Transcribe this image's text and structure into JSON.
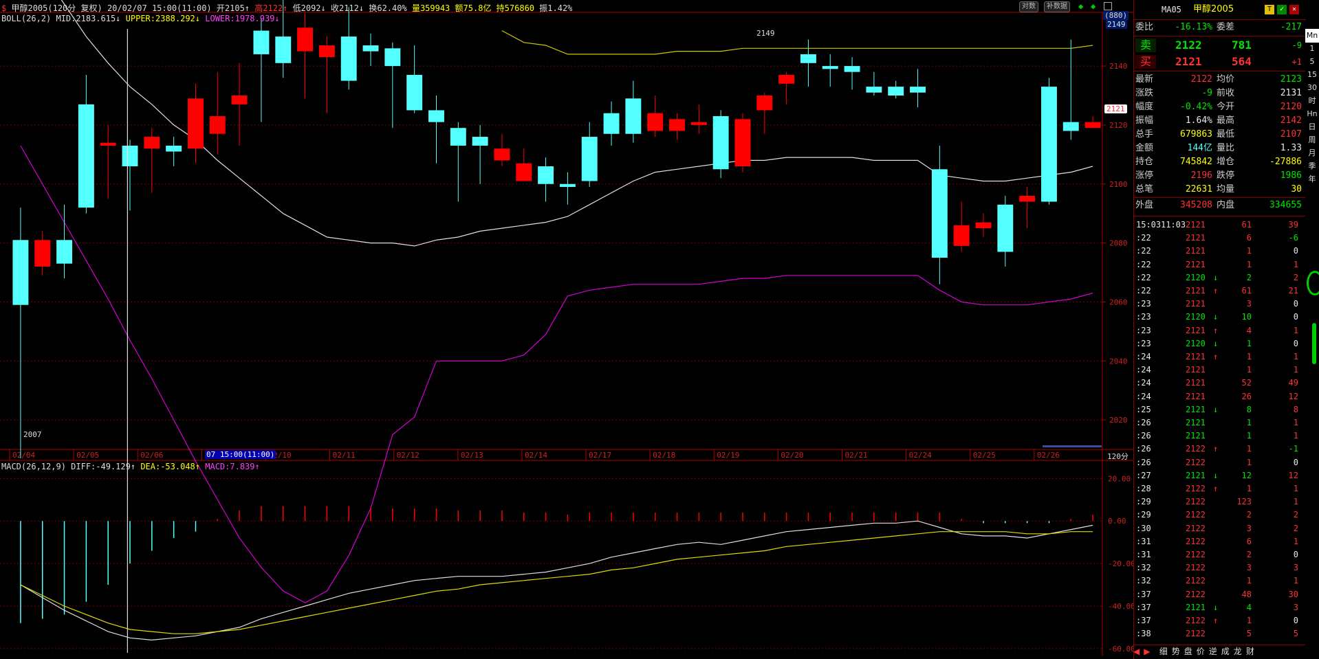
{
  "header": {
    "symbol_title": "甲醇2005(120分 复权) 20/02/07 15:00(11:00)",
    "open": "开2105↑",
    "high": "高2122↑",
    "low": "低2092↓",
    "close": "收2112↓",
    "turnover": "换62.40%",
    "volume": "量359943",
    "amount": "额75.8亿",
    "position": "持576860",
    "amplitude": "振1.42%",
    "btn_period": "对数",
    "btn_supplement": "补数据"
  },
  "boll_header": {
    "name": "BOLL(26,2)",
    "mid": "MID:2183.615↓",
    "upper": "UPPER:2388.292↓",
    "lower": "LOWER:1978.939↓"
  },
  "macd_header": {
    "name": "MACD(26,12,9)",
    "diff": "DIFF:-49.129↑",
    "dea": "DEA:-53.048↑",
    "macd": "MACD:7.839↑"
  },
  "price_axis": {
    "top_badge_1": "(880)",
    "top_badge_2": "2149",
    "labels": [
      "2140",
      "2120",
      "2100",
      "2080",
      "2060",
      "2040",
      "2020"
    ],
    "current_price_tag": "2121",
    "period_label": "120分"
  },
  "macd_axis": {
    "labels": [
      "20.00",
      "0.00",
      "-20.00",
      "-40.00",
      "-60.00"
    ]
  },
  "annotations": {
    "peak_label": "2149",
    "trough_label": "2007",
    "cursor_time": "07 15:00(11:00)"
  },
  "date_axis": {
    "dates": [
      "02/04",
      "02/05",
      "02/06",
      "02/07",
      "02/10",
      "02/11",
      "02/12",
      "02/13",
      "02/14",
      "02/17",
      "02/18",
      "02/19",
      "02/20",
      "02/21",
      "02/24",
      "02/25",
      "02/26"
    ]
  },
  "chart_data": {
    "type": "candlestick",
    "price_range": [
      2000,
      2150
    ],
    "candles": [
      {
        "o": 2081,
        "c": 2059,
        "h": 2092,
        "l": 2007,
        "up": false
      },
      {
        "o": 2072,
        "c": 2081,
        "h": 2084,
        "l": 2069,
        "up": true
      },
      {
        "o": 2081,
        "c": 2073,
        "h": 2093,
        "l": 2068,
        "up": false
      },
      {
        "o": 2127,
        "c": 2092,
        "h": 2137,
        "l": 2090,
        "up": false
      },
      {
        "o": 2113,
        "c": 2114,
        "h": 2120,
        "l": 2095,
        "up": false
      },
      {
        "o": 2113,
        "c": 2106,
        "h": 2115,
        "l": 2091,
        "up": true
      },
      {
        "o": 2112,
        "c": 2116,
        "h": 2119,
        "l": 2097,
        "up": true
      },
      {
        "o": 2113,
        "c": 2111,
        "h": 2116,
        "l": 2106,
        "up": true
      },
      {
        "o": 2112,
        "c": 2129,
        "h": 2134,
        "l": 2107,
        "up": false
      },
      {
        "o": 2117,
        "c": 2123,
        "h": 2138,
        "l": 2110,
        "up": false
      },
      {
        "o": 2127,
        "c": 2130,
        "h": 2141,
        "l": 2113,
        "up": false
      },
      {
        "o": 2152,
        "c": 2144,
        "h": 2156,
        "l": 2121,
        "up": false
      },
      {
        "o": 2150,
        "c": 2141,
        "h": 2163,
        "l": 2136,
        "up": false
      },
      {
        "o": 2145,
        "c": 2153,
        "h": 2158,
        "l": 2129,
        "up": true
      },
      {
        "o": 2143,
        "c": 2147,
        "h": 2150,
        "l": 2124,
        "up": true
      },
      {
        "o": 2150,
        "c": 2135,
        "h": 2160,
        "l": 2132,
        "up": false
      },
      {
        "o": 2147,
        "c": 2145,
        "h": 2151,
        "l": 2140,
        "up": false
      },
      {
        "o": 2146,
        "c": 2140,
        "h": 2148,
        "l": 2119,
        "up": true
      },
      {
        "o": 2137,
        "c": 2125,
        "h": 2147,
        "l": 2124,
        "up": true
      },
      {
        "o": 2125,
        "c": 2121,
        "h": 2130,
        "l": 2107,
        "up": true
      },
      {
        "o": 2119,
        "c": 2113,
        "h": 2121,
        "l": 2094,
        "up": true
      },
      {
        "o": 2116,
        "c": 2113,
        "h": 2120,
        "l": 2100,
        "up": true
      },
      {
        "o": 2108,
        "c": 2112,
        "h": 2117,
        "l": 2106,
        "up": true
      },
      {
        "o": 2101,
        "c": 2107,
        "h": 2112,
        "l": 2104,
        "up": true
      },
      {
        "o": 2106,
        "c": 2100,
        "h": 2109,
        "l": 2094,
        "up": true
      },
      {
        "o": 2100,
        "c": 2099,
        "h": 2104,
        "l": 2093,
        "up": true
      },
      {
        "o": 2116,
        "c": 2101,
        "h": 2121,
        "l": 2099,
        "up": true
      },
      {
        "o": 2124,
        "c": 2117,
        "h": 2128,
        "l": 2113,
        "up": true
      },
      {
        "o": 2129,
        "c": 2117,
        "h": 2135,
        "l": 2114,
        "up": false
      },
      {
        "o": 2118,
        "c": 2124,
        "h": 2130,
        "l": 2116,
        "up": true
      },
      {
        "o": 2118,
        "c": 2122,
        "h": 2124,
        "l": 2115,
        "up": false
      },
      {
        "o": 2120,
        "c": 2121,
        "h": 2127,
        "l": 2117,
        "up": false
      },
      {
        "o": 2123,
        "c": 2105,
        "h": 2125,
        "l": 2102,
        "up": true
      },
      {
        "o": 2106,
        "c": 2122,
        "h": 2124,
        "l": 2104,
        "up": false
      },
      {
        "o": 2125,
        "c": 2130,
        "h": 2131,
        "l": 2117,
        "up": false
      },
      {
        "o": 2134,
        "c": 2137,
        "h": 2138,
        "l": 2127,
        "up": false
      },
      {
        "o": 2144,
        "c": 2141,
        "h": 2149,
        "l": 2133,
        "up": true
      },
      {
        "o": 2140,
        "c": 2139,
        "h": 2144,
        "l": 2133,
        "up": true
      },
      {
        "o": 2140,
        "c": 2138,
        "h": 2143,
        "l": 2132,
        "up": true
      },
      {
        "o": 2133,
        "c": 2131,
        "h": 2138,
        "l": 2130,
        "up": true
      },
      {
        "o": 2133,
        "c": 2130,
        "h": 2135,
        "l": 2129,
        "up": false
      },
      {
        "o": 2133,
        "c": 2131,
        "h": 2139,
        "l": 2126,
        "up": true
      },
      {
        "o": 2105,
        "c": 2075,
        "h": 2113,
        "l": 2066,
        "up": true
      },
      {
        "o": 2079,
        "c": 2086,
        "h": 2094,
        "l": 2077,
        "up": false
      },
      {
        "o": 2085,
        "c": 2087,
        "h": 2090,
        "l": 2082,
        "up": false
      },
      {
        "o": 2093,
        "c": 2077,
        "h": 2096,
        "l": 2072,
        "up": false
      },
      {
        "o": 2094,
        "c": 2096,
        "h": 2099,
        "l": 2085,
        "up": false
      },
      {
        "o": 2133,
        "c": 2094,
        "h": 2136,
        "l": 2093,
        "up": false
      },
      {
        "o": 2121,
        "c": 2118,
        "h": 2149,
        "l": 2115,
        "up": true
      },
      {
        "o": 2119,
        "c": 2121,
        "h": 2123,
        "l": 2119,
        "up": false
      }
    ],
    "boll_mid": [
      2183,
      2172,
      2161,
      2150,
      2141,
      2133,
      2127,
      2120,
      2115,
      2108,
      2102,
      2096,
      2090,
      2086,
      2082,
      2081,
      2080,
      2080,
      2079,
      2081,
      2082,
      2084,
      2085,
      2086,
      2087,
      2089,
      2093,
      2097,
      2101,
      2104,
      2105,
      2106,
      2107,
      2108,
      2108,
      2109,
      2109,
      2109,
      2109,
      2108,
      2108,
      2108,
      2103,
      2102,
      2101,
      2101,
      2102,
      2103,
      2104,
      2106
    ],
    "boll_upper": [
      null,
      null,
      null,
      null,
      null,
      null,
      null,
      null,
      null,
      null,
      null,
      null,
      null,
      null,
      null,
      null,
      null,
      null,
      null,
      null,
      null,
      null,
      2152,
      2148,
      2147,
      2144,
      2144,
      2144,
      2144,
      2144,
      2145,
      2145,
      2145,
      2146,
      2146,
      2146,
      2146,
      2146,
      2146,
      2146,
      2146,
      2146,
      2146,
      2146,
      2146,
      2146,
      2146,
      2146,
      2146,
      2147
    ],
    "boll_lower": [
      2113,
      2100,
      2087,
      2074,
      2061,
      2047,
      2034,
      2020,
      2006,
      1993,
      1980,
      1970,
      1962,
      1958,
      1962,
      1974,
      1990,
      2015,
      2021,
      2040,
      2040,
      2040,
      2040,
      2042,
      2049,
      2062,
      2064,
      2065,
      2066,
      2066,
      2066,
      2066,
      2067,
      2068,
      2068,
      2069,
      2069,
      2069,
      2069,
      2069,
      2069,
      2069,
      2064,
      2060,
      2059,
      2059,
      2059,
      2060,
      2061,
      2063
    ],
    "macd_bars": [
      -48,
      -46,
      -44,
      -38,
      -30,
      -20,
      -14,
      -8,
      -5,
      1,
      5,
      7,
      7,
      7,
      7,
      7,
      6,
      6,
      6,
      6,
      5,
      5,
      5,
      4,
      4,
      3,
      4,
      4,
      4,
      4,
      4,
      4,
      4,
      4,
      4,
      4,
      4,
      4,
      4,
      4,
      4,
      4,
      4,
      1,
      -1,
      -1,
      -1,
      -1,
      1,
      3
    ],
    "macd_diff": [
      -30,
      -36,
      -42,
      -47,
      -52,
      -55,
      -56,
      -55,
      -54,
      -52,
      -50,
      -46,
      -43,
      -40,
      -37,
      -34,
      -32,
      -30,
      -28,
      -27,
      -26,
      -26,
      -26,
      -25,
      -24,
      -22,
      -20,
      -17,
      -15,
      -13,
      -11,
      -10,
      -11,
      -9,
      -7,
      -5,
      -4,
      -3,
      -2,
      -1,
      -1,
      0,
      -3,
      -6,
      -7,
      -7,
      -8,
      -6,
      -4,
      -2
    ],
    "macd_dea": [
      -30,
      -35,
      -40,
      -44,
      -48,
      -51,
      -52,
      -53,
      -53,
      -52,
      -51,
      -49,
      -47,
      -45,
      -43,
      -41,
      -39,
      -37,
      -35,
      -33,
      -32,
      -30,
      -29,
      -28,
      -27,
      -26,
      -25,
      -23,
      -22,
      -20,
      -18,
      -17,
      -16,
      -15,
      -14,
      -12,
      -11,
      -10,
      -9,
      -8,
      -7,
      -6,
      -5,
      -5,
      -5,
      -5,
      -6,
      -6,
      -5,
      -5
    ]
  },
  "right_panel": {
    "title_ma": "MA05",
    "title_name": "甲醇2005",
    "icon_t": "T",
    "weibi_label": "委比",
    "weibi_value": "-16.13%",
    "weicha_label": "委差",
    "weicha_value": "-217",
    "sell_label": "卖",
    "sell_price": "2122",
    "sell_qty": "781",
    "sell_diff": "-9",
    "buy_label": "买",
    "buy_price": "2121",
    "buy_qty": "564",
    "buy_diff": "+1",
    "stats": [
      {
        "l1": "最新",
        "v1": "2122",
        "c1": "red",
        "l2": "均价",
        "v2": "2123",
        "c2": "green"
      },
      {
        "l1": "涨跌",
        "v1": "-9",
        "c1": "green",
        "l2": "前收",
        "v2": "2131",
        "c2": "white"
      },
      {
        "l1": "幅度",
        "v1": "-0.42%",
        "c1": "green",
        "l2": "今开",
        "v2": "2120",
        "c2": "red"
      },
      {
        "l1": "振幅",
        "v1": "1.64%",
        "c1": "white",
        "l2": "最高",
        "v2": "2142",
        "c2": "red"
      },
      {
        "l1": "总手",
        "v1": "679863",
        "c1": "yellow",
        "l2": "最低",
        "v2": "2107",
        "c2": "red"
      },
      {
        "l1": "金额",
        "v1": "144亿",
        "c1": "cyan",
        "l2": "量比",
        "v2": "1.33",
        "c2": "white"
      },
      {
        "l1": "持仓",
        "v1": "745842",
        "c1": "yellow",
        "l2": "增仓",
        "v2": "-27886",
        "c2": "yellow"
      },
      {
        "l1": "涨停",
        "v1": "2196",
        "c1": "red",
        "l2": "跌停",
        "v2": "1986",
        "c2": "green"
      },
      {
        "l1": "总笔",
        "v1": "22631",
        "c1": "yellow",
        "l2": "均量",
        "v2": "30",
        "c2": "yellow"
      }
    ],
    "outer_label": "外盘",
    "outer_value": "345208",
    "inner_label": "内盘",
    "inner_value": "334655",
    "ticks": [
      {
        "t": "15:03",
        "t2": "11:03",
        "p": "2121",
        "a": "",
        "v": "61",
        "d": "39",
        "vc": "red",
        "dc": "red"
      },
      {
        "t": ":22",
        "t2": "",
        "p": "2121",
        "a": "",
        "v": "6",
        "d": "-6",
        "vc": "red",
        "dc": "green"
      },
      {
        "t": ":22",
        "t2": "",
        "p": "2121",
        "a": "",
        "v": "1",
        "d": "0",
        "vc": "red",
        "dc": "white"
      },
      {
        "t": ":22",
        "t2": "",
        "p": "2121",
        "a": "",
        "v": "1",
        "d": "1",
        "vc": "red",
        "dc": "red"
      },
      {
        "t": ":22",
        "t2": "",
        "p": "2120",
        "a": "↓",
        "v": "2",
        "d": "2",
        "vc": "green",
        "dc": "red"
      },
      {
        "t": ":22",
        "t2": "",
        "p": "2121",
        "a": "↑",
        "v": "61",
        "d": "21",
        "vc": "red",
        "dc": "red"
      },
      {
        "t": ":23",
        "t2": "",
        "p": "2121",
        "a": "",
        "v": "3",
        "d": "0",
        "vc": "red",
        "dc": "white"
      },
      {
        "t": ":23",
        "t2": "",
        "p": "2120",
        "a": "↓",
        "v": "10",
        "d": "0",
        "vc": "green",
        "dc": "white"
      },
      {
        "t": ":23",
        "t2": "",
        "p": "2121",
        "a": "↑",
        "v": "4",
        "d": "1",
        "vc": "red",
        "dc": "red"
      },
      {
        "t": ":23",
        "t2": "",
        "p": "2120",
        "a": "↓",
        "v": "1",
        "d": "0",
        "vc": "green",
        "dc": "white"
      },
      {
        "t": ":24",
        "t2": "",
        "p": "2121",
        "a": "↑",
        "v": "1",
        "d": "1",
        "vc": "red",
        "dc": "red"
      },
      {
        "t": ":24",
        "t2": "",
        "p": "2121",
        "a": "",
        "v": "1",
        "d": "1",
        "vc": "red",
        "dc": "red"
      },
      {
        "t": ":24",
        "t2": "",
        "p": "2121",
        "a": "",
        "v": "52",
        "d": "49",
        "vc": "red",
        "dc": "red"
      },
      {
        "t": ":24",
        "t2": "",
        "p": "2121",
        "a": "",
        "v": "26",
        "d": "12",
        "vc": "red",
        "dc": "red"
      },
      {
        "t": ":25",
        "t2": "",
        "p": "2121",
        "a": "↓",
        "v": "8",
        "d": "8",
        "vc": "green",
        "dc": "red"
      },
      {
        "t": ":26",
        "t2": "",
        "p": "2121",
        "a": "",
        "v": "1",
        "d": "1",
        "vc": "green",
        "dc": "red"
      },
      {
        "t": ":26",
        "t2": "",
        "p": "2121",
        "a": "",
        "v": "1",
        "d": "1",
        "vc": "green",
        "dc": "red"
      },
      {
        "t": ":26",
        "t2": "",
        "p": "2122",
        "a": "↑",
        "v": "1",
        "d": "-1",
        "vc": "red",
        "dc": "green"
      },
      {
        "t": ":26",
        "t2": "",
        "p": "2122",
        "a": "",
        "v": "1",
        "d": "0",
        "vc": "red",
        "dc": "white"
      },
      {
        "t": ":27",
        "t2": "",
        "p": "2121",
        "a": "↓",
        "v": "12",
        "d": "12",
        "vc": "green",
        "dc": "red"
      },
      {
        "t": ":28",
        "t2": "",
        "p": "2122",
        "a": "↑",
        "v": "1",
        "d": "1",
        "vc": "red",
        "dc": "red"
      },
      {
        "t": ":29",
        "t2": "",
        "p": "2122",
        "a": "",
        "v": "123",
        "d": "1",
        "vc": "red",
        "dc": "red"
      },
      {
        "t": ":29",
        "t2": "",
        "p": "2122",
        "a": "",
        "v": "2",
        "d": "2",
        "vc": "red",
        "dc": "red"
      },
      {
        "t": ":30",
        "t2": "",
        "p": "2122",
        "a": "",
        "v": "3",
        "d": "2",
        "vc": "red",
        "dc": "red"
      },
      {
        "t": ":31",
        "t2": "",
        "p": "2122",
        "a": "",
        "v": "6",
        "d": "1",
        "vc": "red",
        "dc": "red"
      },
      {
        "t": ":31",
        "t2": "",
        "p": "2122",
        "a": "",
        "v": "2",
        "d": "0",
        "vc": "red",
        "dc": "white"
      },
      {
        "t": ":32",
        "t2": "",
        "p": "2122",
        "a": "",
        "v": "3",
        "d": "3",
        "vc": "red",
        "dc": "red"
      },
      {
        "t": ":32",
        "t2": "",
        "p": "2122",
        "a": "",
        "v": "1",
        "d": "1",
        "vc": "red",
        "dc": "red"
      },
      {
        "t": ":37",
        "t2": "",
        "p": "2122",
        "a": "",
        "v": "48",
        "d": "30",
        "vc": "red",
        "dc": "red"
      },
      {
        "t": ":37",
        "t2": "",
        "p": "2121",
        "a": "↓",
        "v": "4",
        "d": "3",
        "vc": "green",
        "dc": "red"
      },
      {
        "t": ":37",
        "t2": "",
        "p": "2122",
        "a": "↑",
        "v": "1",
        "d": "0",
        "vc": "red",
        "dc": "white"
      },
      {
        "t": ":38",
        "t2": "",
        "p": "2122",
        "a": "",
        "v": "5",
        "d": "5",
        "vc": "red",
        "dc": "red"
      }
    ],
    "bottom_tabs": [
      "细",
      "势",
      "盘",
      "价",
      "逆",
      "成",
      "龙",
      "财"
    ]
  },
  "side_tabs": [
    "Mn",
    "1",
    "5",
    "15",
    "30",
    "时",
    "Hn",
    "日",
    "周",
    "月",
    "季",
    "年"
  ],
  "colors": {
    "up": "#ff0000",
    "down": "#54ffff",
    "mid": "#e0e0e0",
    "upper": "#cccc00",
    "lower": "#d600d6",
    "grid": "#800000",
    "axis": "#b00000"
  }
}
